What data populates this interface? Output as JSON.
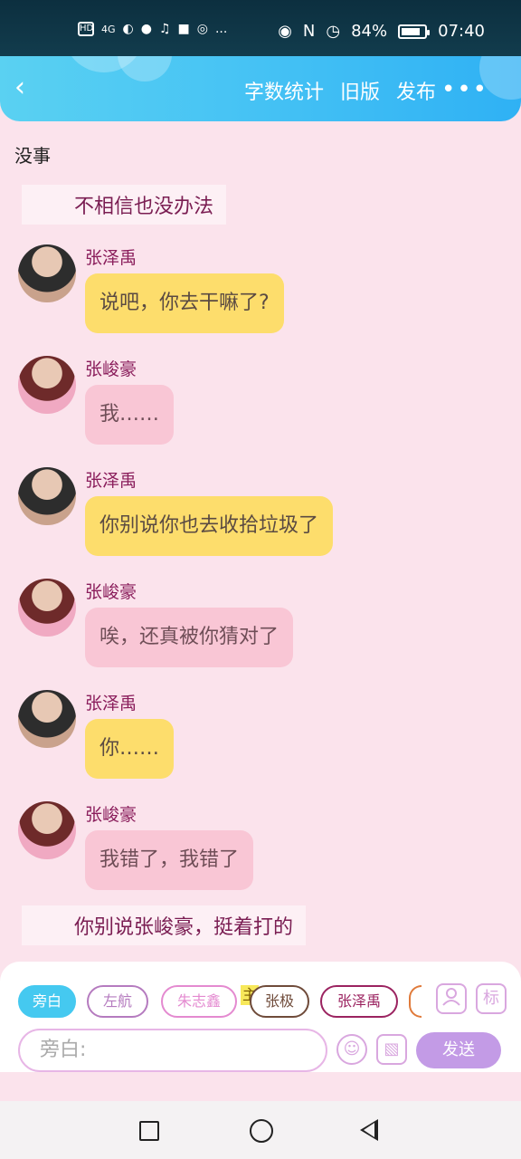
{
  "status_bar": {
    "left_icons": [
      "HD",
      "4G",
      "wifi-icon",
      "message-icon",
      "music-icon",
      "app-icon",
      "vpn-icon",
      "..."
    ],
    "eye_icon": "eye-icon",
    "nfc_icon": "N",
    "battery": "84%",
    "battery_level": 0.84,
    "time": "07:40"
  },
  "app_bar": {
    "back_icon": "‹",
    "actions": [
      "字数统计",
      "旧版",
      "发布"
    ],
    "more": "•••"
  },
  "chat": {
    "top_text": "没事",
    "narration_1": "不相信也没办法",
    "messages": [
      {
        "speaker": "张泽禹",
        "text": "说吧，你去干嘛了?",
        "style": "yellow"
      },
      {
        "speaker": "张峻豪",
        "text": "我……",
        "style": "pink"
      },
      {
        "speaker": "张泽禹",
        "text": "你别说你也去收拾垃圾了",
        "style": "yellow"
      },
      {
        "speaker": "张峻豪",
        "text": "唉，还真被你猜对了",
        "style": "pink"
      },
      {
        "speaker": "张泽禹",
        "text": "你……",
        "style": "yellow"
      },
      {
        "speaker": "张峻豪",
        "text": "我错了，我错了",
        "style": "pink"
      }
    ],
    "narration_2": "你别说张峻豪，挺着打的"
  },
  "panel": {
    "chips": [
      "旁白",
      "左航",
      "朱志鑫",
      "张极",
      "张泽禹"
    ],
    "main_badge": "主",
    "icons": [
      "person-icon",
      "标"
    ],
    "input_placeholder": "旁白:",
    "emoji_icon": "☺",
    "image_icon": "▧",
    "send_label": "发送"
  },
  "colors": {
    "accent_blue": "#45c2f4",
    "bubble_yellow": "#fddd6c",
    "bubble_pink": "#f9c6d5",
    "name_color": "#8a1d5b",
    "send_purple": "#c39be6"
  }
}
